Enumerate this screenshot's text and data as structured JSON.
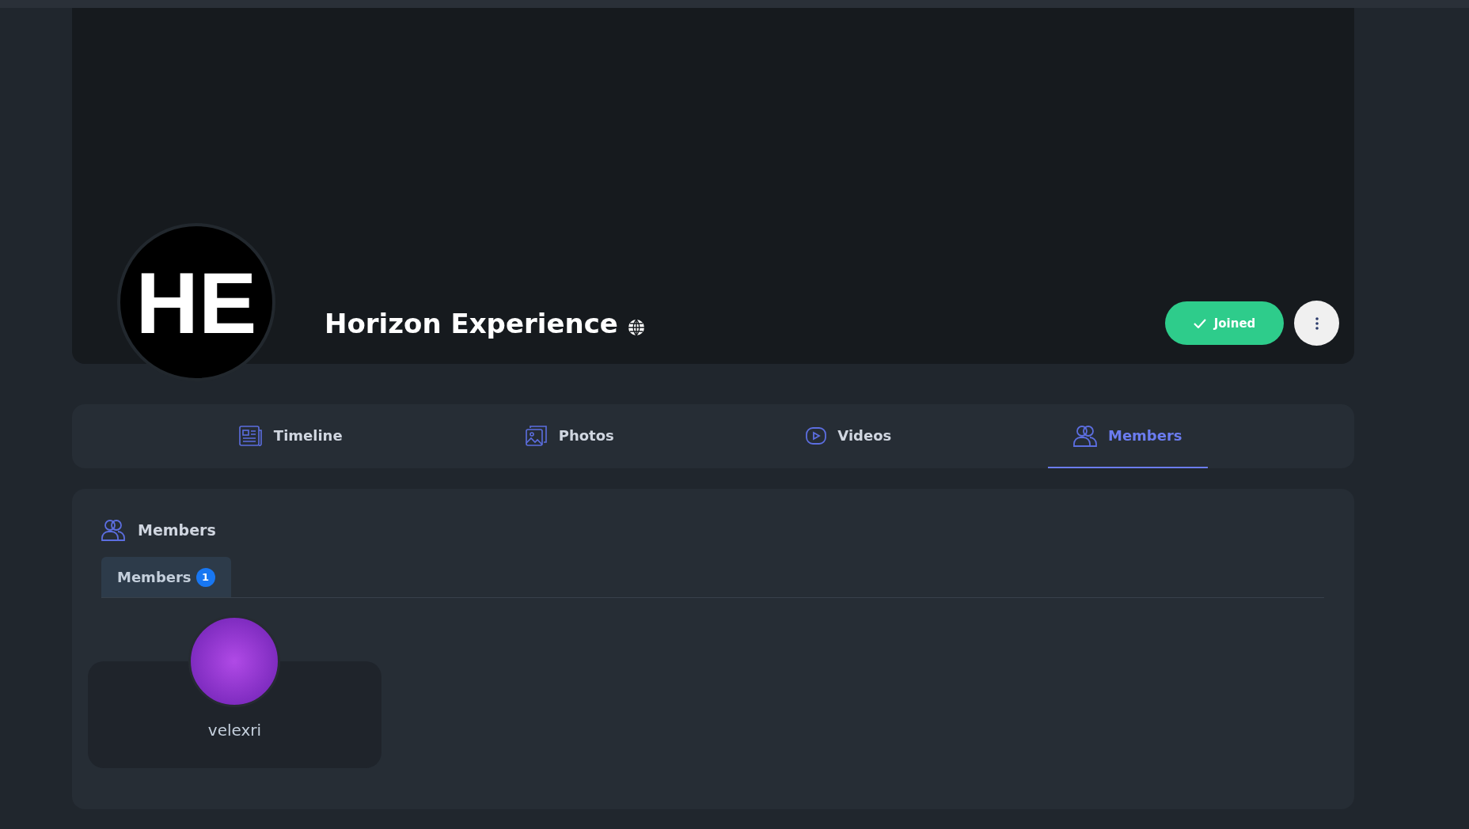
{
  "group": {
    "logo_text": "HE",
    "name": "Horizon Experience",
    "joined_button": "Joined"
  },
  "tabs": [
    {
      "label": "Timeline",
      "selected": false
    },
    {
      "label": "Photos",
      "selected": false
    },
    {
      "label": "Videos",
      "selected": false
    },
    {
      "label": "Members",
      "selected": true
    }
  ],
  "members_section": {
    "title": "Members",
    "subtabs": [
      {
        "label": "Members",
        "count": "1",
        "selected": true
      }
    ],
    "members": [
      {
        "name": "velexri"
      }
    ]
  }
}
